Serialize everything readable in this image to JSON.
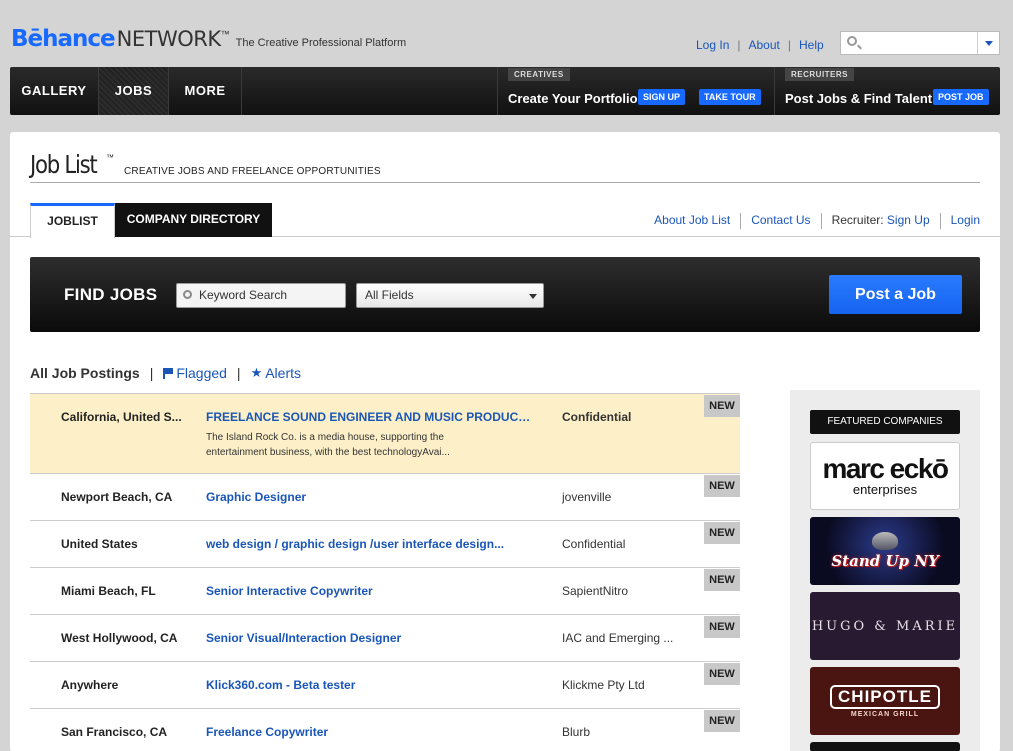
{
  "brand": {
    "logo_be": "Bēhance",
    "logo_network": "NETWORK",
    "logo_tm": "™",
    "tagline": "The Creative Professional Platform"
  },
  "toplinks": {
    "login": "Log In",
    "about": "About",
    "help": "Help"
  },
  "search": {
    "placeholder": ""
  },
  "nav": {
    "gallery": "GALLERY",
    "jobs": "JOBS",
    "more": "MORE",
    "creatives_label": "CREATIVES",
    "creatives_text": "Create Your Portfolio",
    "signup": "SIGN UP",
    "taketour": "TAKE TOUR",
    "recruiters_label": "RECRUITERS",
    "recruiters_text": "Post Jobs & Find Talent",
    "postjob": "POST JOB"
  },
  "page": {
    "title": "Job List",
    "title_tm": "™",
    "subtitle": "CREATIVE JOBS AND FREELANCE OPPORTUNITIES"
  },
  "tabs": {
    "joblist": "JOBLIST",
    "company_directory": "COMPANY DIRECTORY",
    "about_job_list": "About Job List",
    "contact_us": "Contact Us",
    "recruiter_label": "Recruiter:",
    "sign_up": "Sign Up",
    "login": "Login"
  },
  "find": {
    "heading": "FIND JOBS",
    "keyword_placeholder": "Keyword Search",
    "field_selected": "All Fields",
    "post_button": "Post a Job"
  },
  "postings": {
    "all": "All Job Postings",
    "flagged": "Flagged",
    "alerts": "Alerts"
  },
  "jobs": [
    {
      "location": "California, United S...",
      "title": "FREELANCE SOUND ENGINEER AND MUSIC PRODUCER:",
      "description": "The Island Rock Co. is a media house, supporting the entertainment business, with the best technologyAvai...",
      "company": "Confidential",
      "badge": "NEW"
    },
    {
      "location": "Newport Beach, CA",
      "title": "Graphic Designer",
      "company": "jovenville",
      "badge": "NEW"
    },
    {
      "location": "United States",
      "title": "web design / graphic design /user interface design...",
      "company": "Confidential",
      "badge": "NEW"
    },
    {
      "location": "Miami Beach, FL",
      "title": "Senior Interactive Copywriter",
      "company": "SapientNitro",
      "badge": "NEW"
    },
    {
      "location": "West Hollywood, CA",
      "title": "Senior Visual/Interaction Designer",
      "company": "IAC and Emerging ...",
      "badge": "NEW"
    },
    {
      "location": "Anywhere",
      "title": "Klick360.com - Beta tester",
      "company": "Klickme Pty Ltd",
      "badge": "NEW"
    },
    {
      "location": "San Francisco, CA",
      "title": "Freelance Copywriter",
      "company": "Blurb",
      "badge": "NEW"
    }
  ],
  "featured": {
    "heading": "FEATURED COMPANIES",
    "ecko_a": "marc eckō",
    "ecko_b": "enterprises",
    "standup": "Stand Up NY",
    "hugo": "HUGO & MARIE",
    "chipotle_a": "CHIPOTLE",
    "chipotle_b": "MEXICAN GRILL"
  }
}
